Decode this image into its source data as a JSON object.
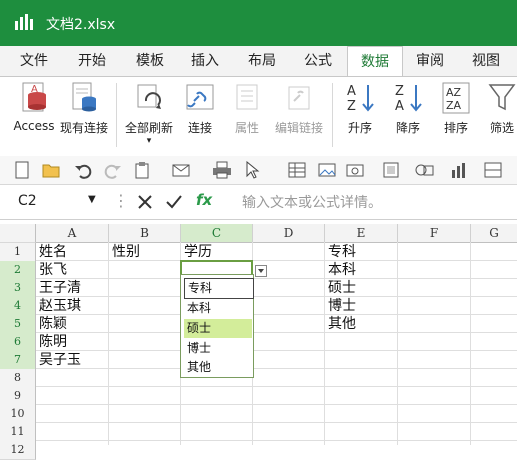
{
  "window": {
    "title": "文档2.xlsx"
  },
  "ribbon_tabs": [
    {
      "label": "文件"
    },
    {
      "label": "开始"
    },
    {
      "label": "模板"
    },
    {
      "label": "插入"
    },
    {
      "label": "布局"
    },
    {
      "label": "公式"
    },
    {
      "label": "数据"
    },
    {
      "label": "审阅"
    },
    {
      "label": "视图"
    }
  ],
  "active_tab": "数据",
  "ribbon": {
    "access": "Access",
    "existing_connection": "现有连接",
    "refresh_all": "全部刷新",
    "connect": "连接",
    "properties": "属性",
    "edit_links": "编辑链接",
    "sort_asc": "升序",
    "sort_desc": "降序",
    "sort": "排序",
    "filter": "筛选"
  },
  "formula_bar": {
    "cell_ref": "C2",
    "placeholder": "输入文本或公式详情。",
    "fx": "fx"
  },
  "columns": [
    "A",
    "B",
    "C",
    "D",
    "E",
    "F",
    "G"
  ],
  "rows": [
    "1",
    "2",
    "3",
    "4",
    "5",
    "6",
    "7",
    "8",
    "9",
    "10",
    "11",
    "12"
  ],
  "cells": {
    "A1": "姓名",
    "B1": "性别",
    "C1": "学历",
    "E1": "专科",
    "A2": "张飞",
    "E2": "本科",
    "A3": "王子清",
    "E3": "硕士",
    "A4": "赵玉琪",
    "E4": "博士",
    "A5": "陈颖",
    "E5": "其他",
    "A6": "陈明",
    "A7": "吴子玉"
  },
  "dropdown": {
    "options": [
      "专科",
      "本科",
      "硕士",
      "博士",
      "其他"
    ],
    "highlighted": "硕士"
  },
  "colors": {
    "titlebar": "#1e8e3e",
    "accent": "#1e7a35",
    "highlight": "#d3ed9a"
  }
}
